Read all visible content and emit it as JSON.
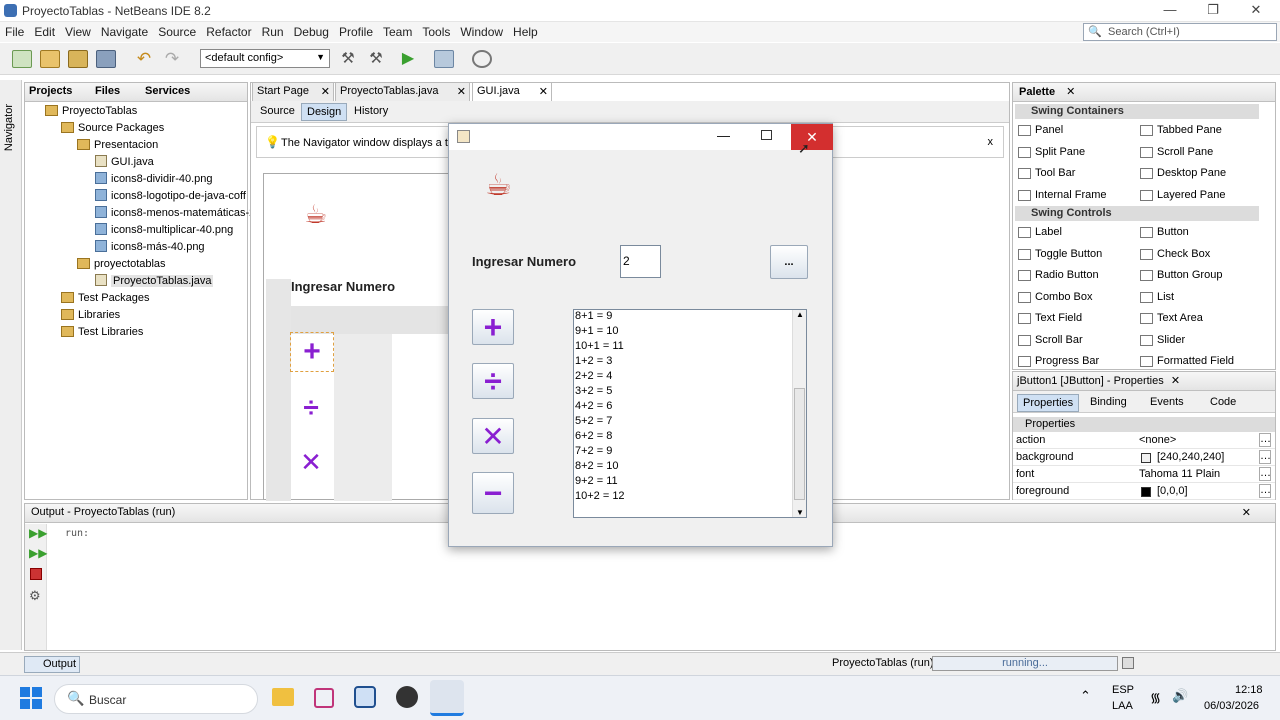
{
  "window": {
    "title": "ProyectoTablas - NetBeans IDE 8.2"
  },
  "menu": [
    "File",
    "Edit",
    "View",
    "Navigate",
    "Source",
    "Refactor",
    "Run",
    "Debug",
    "Profile",
    "Team",
    "Tools",
    "Window",
    "Help"
  ],
  "search": {
    "placeholder": "Search (Ctrl+I)"
  },
  "toolbar": {
    "config": "<default config>"
  },
  "projects_panel": {
    "tabs": [
      "Projects",
      "Files",
      "Services"
    ],
    "tree": [
      {
        "label": "ProyectoTablas",
        "kind": "project"
      },
      {
        "label": "Source Packages",
        "kind": "pkg"
      },
      {
        "label": "Presentacion",
        "kind": "pkg"
      },
      {
        "label": "GUI.java",
        "kind": "file"
      },
      {
        "label": "icons8-dividir-40.png",
        "kind": "img"
      },
      {
        "label": "icons8-logotipo-de-java-coff",
        "kind": "img"
      },
      {
        "label": "icons8-menos-matemáticas-2",
        "kind": "img"
      },
      {
        "label": "icons8-multiplicar-40.png",
        "kind": "img"
      },
      {
        "label": "icons8-más-40.png",
        "kind": "img"
      },
      {
        "label": "proyectotablas",
        "kind": "pkg"
      },
      {
        "label": "ProyectoTablas.java",
        "kind": "file"
      },
      {
        "label": "Test Packages",
        "kind": "pkg"
      },
      {
        "label": "Libraries",
        "kind": "pkg"
      },
      {
        "label": "Test Libraries",
        "kind": "pkg"
      }
    ]
  },
  "navigator_label": "Navigator",
  "editor": {
    "tabs": [
      "Start Page",
      "ProyectoTablas.java",
      "GUI.java"
    ],
    "modes": [
      "Source",
      "Design",
      "History"
    ],
    "hint": "The Navigator window displays a tree",
    "hint_close": "x",
    "design_label": "Ingresar Numero"
  },
  "palette": {
    "title": "Palette",
    "sections": [
      {
        "name": "Swing Containers",
        "items": [
          "Panel",
          "Tabbed Pane",
          "Split Pane",
          "Scroll Pane",
          "Tool Bar",
          "Desktop Pane",
          "Internal Frame",
          "Layered Pane"
        ]
      },
      {
        "name": "Swing Controls",
        "items": [
          "Label",
          "Button",
          "Toggle Button",
          "Check Box",
          "Radio Button",
          "Button Group",
          "Combo Box",
          "List",
          "Text Field",
          "Text Area",
          "Scroll Bar",
          "Slider",
          "Progress Bar",
          "Formatted Field"
        ]
      }
    ]
  },
  "properties": {
    "title": "jButton1 [JButton] - Properties",
    "tabs": [
      "Properties",
      "Binding",
      "Events",
      "Code"
    ],
    "section": "Properties",
    "rows": [
      {
        "name": "action",
        "value": "<none>"
      },
      {
        "name": "background",
        "value": "[240,240,240]"
      },
      {
        "name": "font",
        "value": "Tahoma 11 Plain"
      },
      {
        "name": "foreground",
        "value": "[0,0,0]"
      }
    ]
  },
  "output": {
    "title": "Output - ProyectoTablas (run)",
    "text": "run:",
    "button": "Output"
  },
  "status": {
    "project": "ProyectoTablas (run)",
    "progress": "running..."
  },
  "app_window": {
    "label": "Ingresar Numero",
    "input_value": "2",
    "browse_label": "...",
    "ops": [
      {
        "name": "plus",
        "glyph": "+"
      },
      {
        "name": "divide",
        "glyph": "÷"
      },
      {
        "name": "multiply",
        "glyph": "✕"
      },
      {
        "name": "minus",
        "glyph": "−"
      }
    ],
    "results": [
      "8+1 = 9",
      "9+1 = 10",
      "10+1 = 11",
      "1+2 = 3",
      "2+2 = 4",
      "3+2 = 5",
      "4+2 = 6",
      "5+2 = 7",
      "6+2 = 8",
      "7+2 = 9",
      "8+2 = 10",
      "9+2 = 11",
      "10+2 = 12"
    ]
  },
  "taskbar": {
    "search": "Buscar",
    "lang": "ESP",
    "lang2": "LAA",
    "time": "12:18",
    "date": "06/03/2026"
  }
}
